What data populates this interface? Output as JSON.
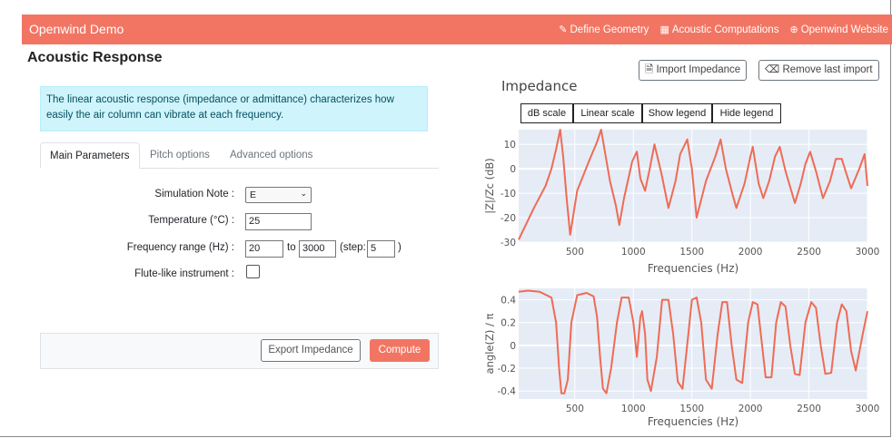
{
  "navbar": {
    "brand": "Openwind Demo",
    "links": [
      {
        "icon": "compass-icon",
        "label": "Define Geometry"
      },
      {
        "icon": "calculator-icon",
        "label": "Acoustic Computations"
      },
      {
        "icon": "globe-icon",
        "label": "Openwind Website"
      }
    ]
  },
  "page": {
    "title": "Acoustic Response"
  },
  "info_text": "The linear acoustic response (impedance or admittance) characterizes how easily the air column can vibrate at each frequency.",
  "tabs": [
    "Main Parameters",
    "Pitch options",
    "Advanced options"
  ],
  "form": {
    "note_label": "Simulation Note :",
    "note_value": "E",
    "temp_label": "Temperature (°C) :",
    "temp_value": "25",
    "freq_label": "Frequency range (Hz) :",
    "freq_min": "20",
    "freq_to": "to",
    "freq_max": "3000",
    "step_open": "(step:",
    "step_value": "5",
    "step_close": ")",
    "flute_label": "Flute-like instrument :"
  },
  "buttons": {
    "export": "Export Impedance",
    "compute": "Compute",
    "import": "Import Impedance",
    "remove": "Remove last import"
  },
  "impedance_title": "Impedance",
  "scale_buttons": [
    "dB scale",
    "Linear scale",
    "Show legend",
    "Hide legend"
  ],
  "colors": {
    "accent": "#f27563",
    "line": "#ef6b55",
    "plot_bg": "#e5ecf6"
  },
  "chart_data": [
    {
      "type": "line",
      "title": "",
      "xlabel": "Frequencies (Hz)",
      "ylabel": "|Z|/Zc (dB)",
      "xlim": [
        20,
        3000
      ],
      "ylim": [
        -30,
        16
      ],
      "xticks": [
        "500",
        "1000",
        "1500",
        "2000",
        "2500",
        "3000"
      ],
      "yticks": [
        "10",
        "0",
        "-10",
        "-20",
        "-30"
      ],
      "x": [
        20,
        150,
        250,
        300,
        340,
        375,
        400,
        430,
        460,
        520,
        620,
        690,
        725,
        760,
        800,
        850,
        880,
        920,
        990,
        1030,
        1060,
        1100,
        1140,
        1180,
        1240,
        1300,
        1360,
        1400,
        1460,
        1500,
        1540,
        1620,
        1700,
        1745,
        1790,
        1850,
        1880,
        1950,
        2000,
        2020,
        2070,
        2110,
        2160,
        2210,
        2250,
        2300,
        2380,
        2430,
        2470,
        2510,
        2560,
        2620,
        2680,
        2730,
        2780,
        2820,
        2860,
        2930,
        2975,
        3000
      ],
      "y": [
        -29,
        -16,
        -7,
        0,
        8,
        16,
        5,
        -12,
        -27,
        -9,
        3,
        11,
        16,
        6,
        -5,
        -15,
        -23,
        -12,
        3,
        7,
        -4,
        -9,
        0,
        10,
        -2,
        -16,
        -5,
        6,
        12,
        0,
        -20,
        -5,
        5,
        12,
        0,
        -11,
        -16,
        -6,
        5,
        9,
        -6,
        -12,
        -5,
        5,
        9,
        -1,
        -14,
        -6,
        2,
        7,
        -1,
        -12,
        -5,
        4,
        4,
        -2,
        -8,
        0,
        6,
        -7
      ]
    },
    {
      "type": "line",
      "title": "",
      "xlabel": "Frequencies (Hz)",
      "ylabel": "angle(Z) / π",
      "xlim": [
        20,
        3000
      ],
      "ylim": [
        -0.47,
        0.5
      ],
      "xticks": [
        "500",
        "1000",
        "1500",
        "2000",
        "2500",
        "3000"
      ],
      "yticks": [
        "0.4",
        "0.2",
        "0",
        "-0.2",
        "-0.4"
      ],
      "x": [
        20,
        100,
        200,
        300,
        340,
        365,
        385,
        410,
        440,
        470,
        520,
        600,
        660,
        690,
        715,
        740,
        770,
        810,
        860,
        900,
        960,
        1000,
        1030,
        1060,
        1075,
        1100,
        1120,
        1150,
        1200,
        1245,
        1300,
        1340,
        1380,
        1420,
        1470,
        1500,
        1540,
        1580,
        1620,
        1670,
        1720,
        1760,
        1800,
        1840,
        1880,
        1930,
        1980,
        2020,
        2060,
        2100,
        2130,
        2180,
        2220,
        2260,
        2300,
        2340,
        2380,
        2420,
        2470,
        2520,
        2560,
        2600,
        2640,
        2690,
        2740,
        2780,
        2820,
        2860,
        2900,
        2960,
        3000
      ],
      "y": [
        0.47,
        0.48,
        0.47,
        0.42,
        0.2,
        -0.2,
        -0.42,
        -0.42,
        -0.3,
        0.2,
        0.44,
        0.46,
        0.43,
        0.25,
        -0.1,
        -0.38,
        -0.42,
        -0.2,
        0.2,
        0.42,
        0.42,
        0.2,
        -0.1,
        0.25,
        0.3,
        0.1,
        -0.3,
        -0.4,
        -0.1,
        0.4,
        0.4,
        0.1,
        -0.32,
        -0.38,
        0.1,
        0.4,
        0.42,
        0.2,
        -0.3,
        -0.38,
        0.1,
        0.38,
        0.38,
        0.0,
        -0.3,
        -0.33,
        0.2,
        0.38,
        0.36,
        0.0,
        -0.28,
        -0.28,
        0.2,
        0.38,
        0.34,
        0.0,
        -0.25,
        -0.26,
        0.2,
        0.38,
        0.33,
        0.0,
        -0.25,
        -0.24,
        0.2,
        0.36,
        0.3,
        -0.05,
        -0.22,
        0.1,
        0.3
      ]
    }
  ]
}
